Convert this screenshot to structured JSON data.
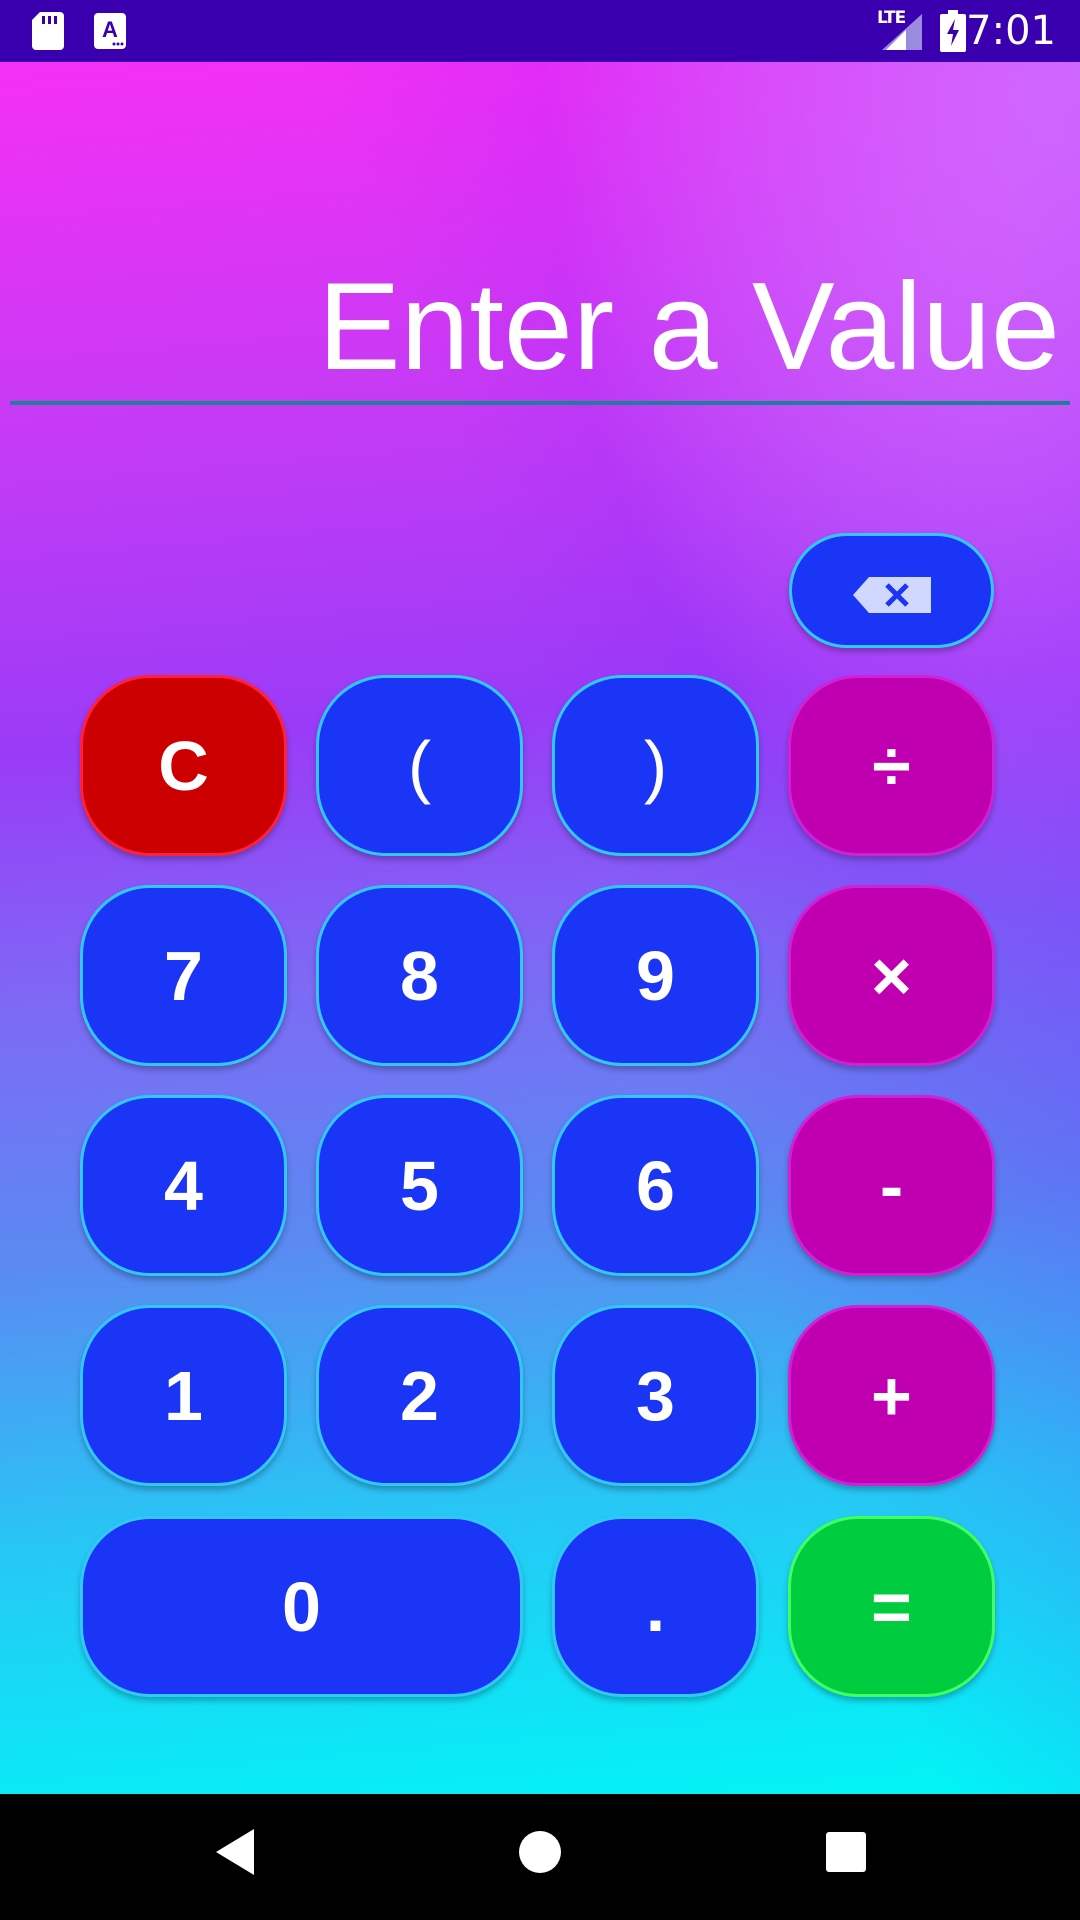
{
  "status_bar": {
    "time": "7:01",
    "network": "LTE",
    "icons": [
      "sd-card-icon",
      "text-input-icon",
      "lte-signal-icon",
      "battery-charging-icon"
    ]
  },
  "display": {
    "placeholder": "Enter a Value",
    "value": ""
  },
  "keypad": {
    "backspace_icon": "backspace-icon",
    "clear": "C",
    "open_paren": "(",
    "close_paren": ")",
    "divide": "÷",
    "seven": "7",
    "eight": "8",
    "nine": "9",
    "multiply": "×",
    "four": "4",
    "five": "5",
    "six": "6",
    "minus": "-",
    "one": "1",
    "two": "2",
    "three": "3",
    "plus": "+",
    "zero": "0",
    "decimal": ".",
    "equals": "="
  },
  "colors": {
    "number_button": "#1a35f6",
    "clear_button": "#cc0000",
    "operator_button": "#c000b0",
    "equals_button": "#00cc40",
    "status_bar": "#3a00b0"
  },
  "nav_bar": {
    "icons": [
      "back-icon",
      "home-icon",
      "recents-icon"
    ]
  }
}
